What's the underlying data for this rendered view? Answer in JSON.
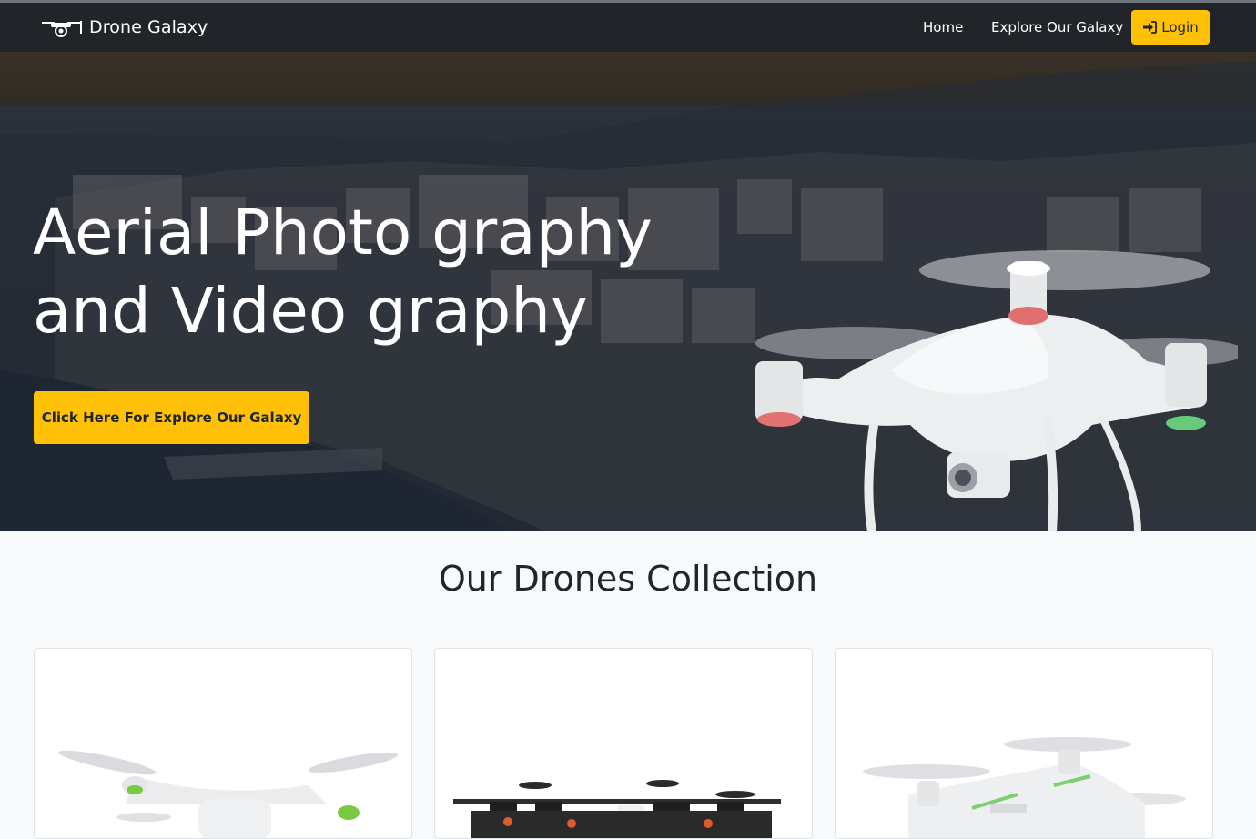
{
  "navbar": {
    "brand": "Drone Galaxy",
    "brand_icon": "drone-logo-icon",
    "links": [
      "Home",
      "Explore Our Galaxy"
    ],
    "login_label": "Login",
    "login_icon": "sign-in-icon"
  },
  "hero": {
    "title_line1": "Aerial Photo graphy",
    "title_line2": "and Video graphy",
    "cta_label": "Click Here For Explore Our Galaxy"
  },
  "collection": {
    "title": "Our Drones Collection",
    "cards": [
      {
        "image": "white-drone-photo"
      },
      {
        "image": "black-agricultural-drone-photo"
      },
      {
        "image": "white-quadcopter-photo"
      }
    ]
  },
  "colors": {
    "navbar_bg": "#212529",
    "accent": "#ffc107",
    "page_bg": "#f8f9fa"
  }
}
